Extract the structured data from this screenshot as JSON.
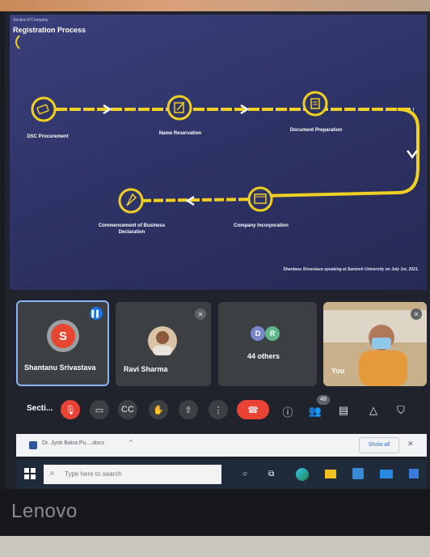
{
  "slide": {
    "breadcrumb": "Section 8 Company",
    "title": "Registration Process",
    "steps": [
      {
        "label": "DSC Procurement"
      },
      {
        "label": "Name Reservation"
      },
      {
        "label": "Document Preparation"
      },
      {
        "label": "Company Incorporation"
      },
      {
        "label": "Commencement of Business Declaration"
      }
    ],
    "credit": "Shantanu Srivastava speaking at Santosh University on July 1st, 2021."
  },
  "participants": [
    {
      "name": "Shantanu Srivastava",
      "initial": "S",
      "avatar_color": "#e8472f"
    },
    {
      "name": "Ravi Sharma"
    },
    {
      "others_label": "44 others",
      "initial1": "D",
      "initial2": "R"
    },
    {
      "name": "You"
    }
  ],
  "controls": {
    "meeting_label": "Secti...",
    "participants_count": "48"
  },
  "download": {
    "file_name": "Dr. Jyoti Batra Pu....docx",
    "show_all": "Show all",
    "close": "✕"
  },
  "taskbar": {
    "search_placeholder": "Type here to search"
  },
  "monitor": {
    "brand": "Lenovo"
  },
  "colors": {
    "accent_yellow": "#f0d020",
    "end_call": "#ea4335",
    "mute_red": "#ea4335",
    "active_border": "#8ab4f8"
  }
}
